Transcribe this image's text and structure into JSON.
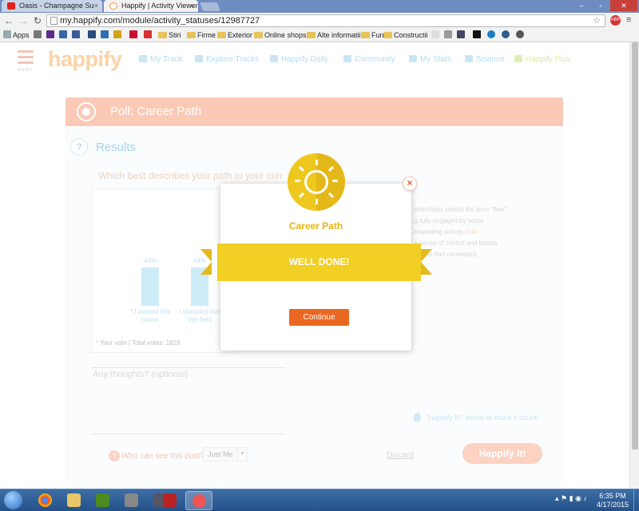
{
  "browser": {
    "tabs": [
      {
        "title": "Oasis - Champagne Su",
        "close": "×"
      },
      {
        "title": "Happify | Activity Viewer",
        "close": "×"
      }
    ],
    "url": "my.happify.com/module/activity_statuses/12987727",
    "bookmarks": [
      {
        "label": "Apps"
      },
      {
        "label": ""
      },
      {
        "label": ""
      },
      {
        "label": ""
      },
      {
        "label": ""
      },
      {
        "label": ""
      },
      {
        "label": ""
      },
      {
        "label": ""
      },
      {
        "label": ""
      },
      {
        "label": ""
      },
      {
        "label": "Stiri",
        "folder": true
      },
      {
        "label": "Firme",
        "folder": true
      },
      {
        "label": "Exterior",
        "folder": true
      },
      {
        "label": "Online shops",
        "folder": true
      },
      {
        "label": "Alte informatii",
        "folder": true
      },
      {
        "label": "Fun",
        "folder": true
      },
      {
        "label": "Constructii",
        "folder": true
      }
    ]
  },
  "site": {
    "logo": "happify",
    "menu_label": "MENU",
    "nav": [
      {
        "label": "My Track"
      },
      {
        "label": "Explore Tracks"
      },
      {
        "label": "Happify Daily"
      },
      {
        "label": "Community"
      },
      {
        "label": "My Stats"
      },
      {
        "label": "Science"
      },
      {
        "label": "Happify Plus"
      }
    ]
  },
  "poll": {
    "header_title": "Poll: Career Path",
    "results_title": "Results",
    "question": "Which best describes your path to your curr",
    "chart_data": {
      "type": "bar",
      "categories": [
        "I wanted this career",
        "I stumbled into this field"
      ],
      "values": [
        44,
        44
      ],
      "value_labels": [
        "44%",
        "44%"
      ],
      "ylim": [
        0,
        100
      ],
      "voted_marker": "*",
      "grid": false
    },
    "votes_text": "Your vote | Total votes: 1818",
    "side_text": {
      "line1": "...entmihalyi coined the term \"flow\"",
      "line2": "...g fully engaged by some",
      "line3": "...rewarding activity.",
      "ref": "(1-11)",
      "line4": "...a sense of control and boosts",
      "line5": "...kes us feel connected,"
    },
    "thoughts_placeholder": "Any thoughts? (optional)",
    "hint": "\"Happify It!\" below to make it count!",
    "who_label": "Who can see this post?",
    "visibility_value": "Just Me",
    "discard_label": "Discard",
    "submit_label": "Happify It!"
  },
  "modal": {
    "title": "Career Path",
    "banner": "WELL DONE!",
    "continue_label": "Continue",
    "close_label": "×"
  },
  "taskbar": {
    "time": "6:35 PM",
    "date": "4/17/2015"
  },
  "colors": {
    "accent_orange": "#ea6722",
    "poll_header": "#fbcab6",
    "ribbon_yellow": "#f2cf24",
    "sun_yellow": "#efc81f"
  }
}
